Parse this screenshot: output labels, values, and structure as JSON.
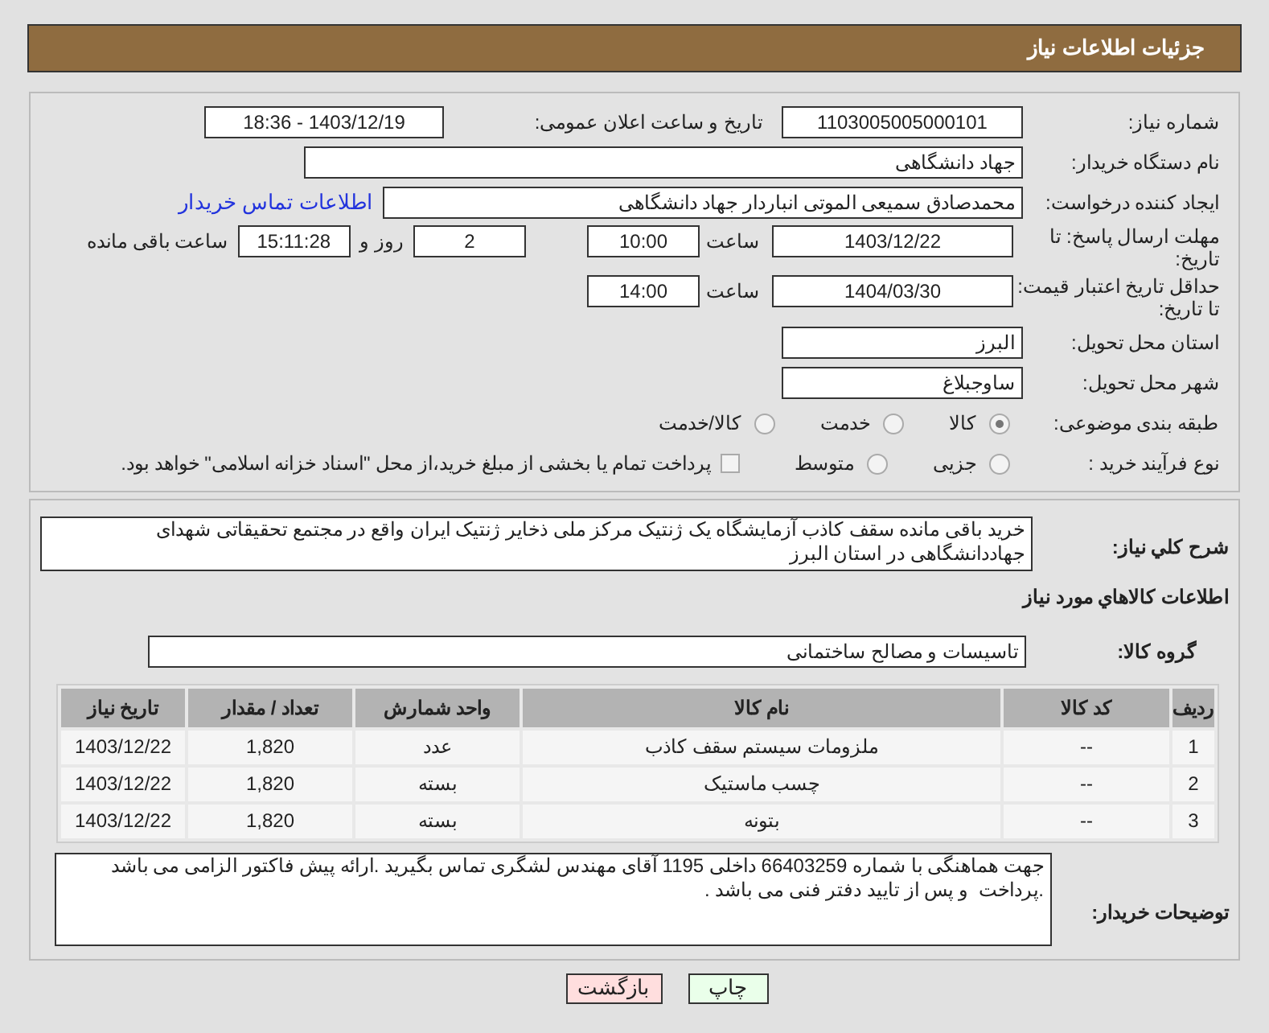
{
  "header": {
    "title": "جزئیات اطلاعات نیاز"
  },
  "need_number": {
    "label": "شماره نیاز:",
    "value": "1103005005000101"
  },
  "announce": {
    "label": "تاریخ و ساعت اعلان عمومی:",
    "value": "1403/12/19 - 18:36"
  },
  "buyer_org": {
    "label": "نام دستگاه خریدار:",
    "value": "جهاد دانشگاهی"
  },
  "requester": {
    "label": "ایجاد کننده درخواست:",
    "value": "محمدصادق سمیعی الموتی انباردار جهاد دانشگاهی",
    "link": "اطلاعات تماس خریدار"
  },
  "reply_deadline": {
    "label": "مهلت ارسال پاسخ: تا تاریخ:",
    "date": "1403/12/22",
    "time_label": "ساعت",
    "time": "10:00",
    "days": "2",
    "days_label": "روز و",
    "remaining": "15:11:28",
    "remaining_label": "ساعت باقی مانده"
  },
  "price_validity": {
    "label": "حداقل تاریخ اعتبار قیمت: تا تاریخ:",
    "date": "1404/03/30",
    "time_label": "ساعت",
    "time": "14:00"
  },
  "province": {
    "label": "استان محل تحویل:",
    "value": "البرز"
  },
  "city": {
    "label": "شهر محل تحویل:",
    "value": "ساوجبلاغ"
  },
  "category": {
    "label": "طبقه بندی موضوعی:",
    "options": [
      {
        "label": "کالا",
        "selected": true
      },
      {
        "label": "خدمت",
        "selected": false
      },
      {
        "label": "کالا/خدمت",
        "selected": false
      }
    ]
  },
  "process": {
    "label": "نوع فرآیند خرید :",
    "options": [
      {
        "label": "جزیی",
        "selected": false
      },
      {
        "label": "متوسط",
        "selected": false
      }
    ],
    "treasury": {
      "label": "پرداخت تمام یا بخشی از مبلغ خرید،از محل \"اسناد خزانه اسلامی\" خواهد بود.",
      "checked": false
    }
  },
  "description": {
    "label": "شرح کلي نياز:",
    "value": "خرید باقی مانده سقف کاذب آزمایشگاه یک ژنتیک مرکز ملی ذخایر ژنتیک ایران واقع در مجتمع تحقیقاتی شهدای جهاددانشگاهی در استان البرز"
  },
  "goods_title": "اطلاعات کالاهاي مورد نياز",
  "goods_group": {
    "label": "گروه کالا:",
    "value": "تاسیسات و مصالح ساختمانی"
  },
  "table": {
    "columns": [
      "ردیف",
      "کد کالا",
      "نام کالا",
      "واحد شمارش",
      "تعداد / مقدار",
      "تاریخ نیاز"
    ],
    "rows": [
      [
        "1",
        "--",
        "ملزومات سیستم سقف کاذب",
        "عدد",
        "1,820",
        "1403/12/22"
      ],
      [
        "2",
        "--",
        "چسب ماستیک",
        "بسته",
        "1,820",
        "1403/12/22"
      ],
      [
        "3",
        "--",
        "بتونه",
        "بسته",
        "1,820",
        "1403/12/22"
      ]
    ]
  },
  "buyer_notes": {
    "label": "توضیحات خریدار:",
    "lines": [
      "جهت هماهنگی با شماره 66403259 داخلی 1195 آقای مهندس لشگری تماس بگیرید .ارائه پیش فاکتور الزامی می باشد",
      ".پرداخت  و پس از تایید دفتر فنی می باشد ."
    ]
  },
  "buttons": [
    {
      "label": "چاپ",
      "kind": "print"
    },
    {
      "label": "بازگشت",
      "kind": "back"
    }
  ]
}
